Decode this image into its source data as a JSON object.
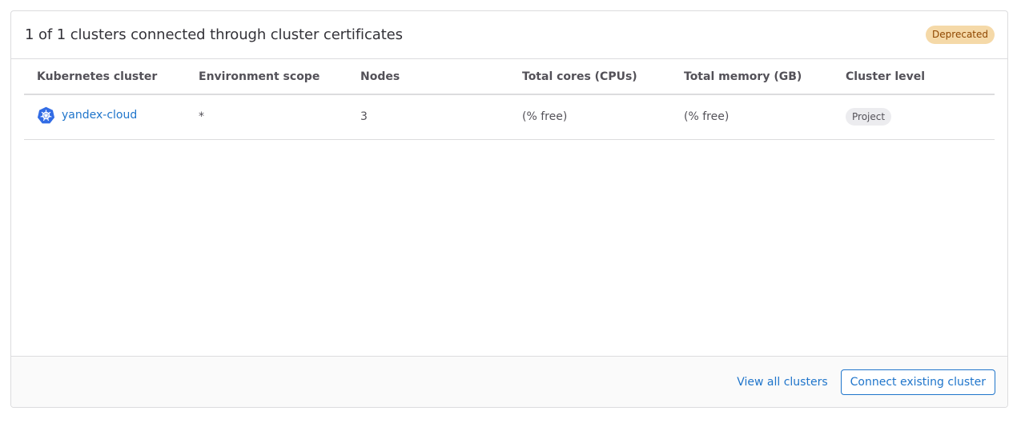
{
  "panel": {
    "title": "1 of 1 clusters connected through cluster certificates",
    "deprecated_badge": "Deprecated"
  },
  "table": {
    "headers": [
      "Kubernetes cluster",
      "Environment scope",
      "Nodes",
      "Total cores (CPUs)",
      "Total memory (GB)",
      "Cluster level"
    ],
    "rows": [
      {
        "icon": "kubernetes-icon",
        "name": "yandex-cloud",
        "environment_scope": "*",
        "nodes": "3",
        "total_cores": "(% free)",
        "total_memory": "(% free)",
        "cluster_level": "Project"
      }
    ]
  },
  "footer": {
    "view_all_label": "View all clusters",
    "connect_label": "Connect existing cluster"
  },
  "colors": {
    "link": "#1f75cb",
    "kubernetes_blue": "#326ce5",
    "deprecated_bg": "#f5d9a8",
    "deprecated_text": "#8f4700"
  }
}
